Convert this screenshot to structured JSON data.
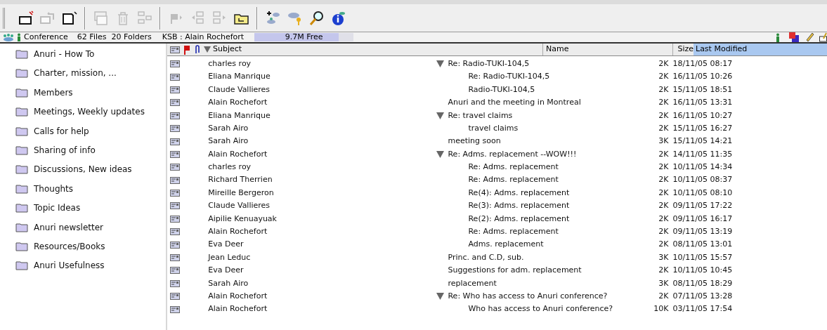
{
  "toolbar": {
    "groups": [
      [
        {
          "disabled": false
        },
        {
          "disabled": true
        },
        {
          "disabled": false
        }
      ],
      [
        {
          "disabled": true
        },
        {
          "disabled": true
        },
        {
          "disabled": true
        }
      ],
      [
        {
          "disabled": true
        },
        {
          "disabled": true
        },
        {
          "disabled": true
        },
        {
          "disabled": false
        }
      ],
      [
        {
          "disabled": false
        },
        {
          "disabled": false
        },
        {
          "disabled": false
        },
        {
          "disabled": false
        }
      ]
    ]
  },
  "status_bar": {
    "conference": "Conference",
    "files": "62 Files",
    "folders": "20 Folders",
    "user": "KSB : Alain Rochefort",
    "free_space": {
      "label": "9.7M Free",
      "level": 0.85
    }
  },
  "sidebar": {
    "items": [
      {
        "label": "Anuri - How To"
      },
      {
        "label": "Charter, mission, ..."
      },
      {
        "label": "Members"
      },
      {
        "label": "Meetings, Weekly updates"
      },
      {
        "label": "Calls for help"
      },
      {
        "label": "Sharing of info"
      },
      {
        "label": "Discussions, New ideas"
      },
      {
        "label": "Thoughts"
      },
      {
        "label": "Topic Ideas"
      },
      {
        "label": "Anuri newsletter"
      },
      {
        "label": "Resources/Books"
      },
      {
        "label": "Anuri Usefulness"
      }
    ]
  },
  "table": {
    "columns": [
      {
        "label": "Subject",
        "selected": false
      },
      {
        "label": "Name",
        "selected": false
      },
      {
        "label": "Size",
        "selected": false
      },
      {
        "label": "Last Modified",
        "selected": true
      }
    ],
    "rows": [
      {
        "sender": "charles roy",
        "subject": "Re: Radio-TUKI-104,5",
        "size": "2K",
        "modified": "18/11/05 08:17",
        "expanded": true,
        "children": [
          {
            "sender": "Eliana Manrique",
            "subject": "Re: Radio-TUKI-104,5",
            "size": "2K",
            "modified": "16/11/05 10:26"
          },
          {
            "sender": "Claude Vallieres",
            "subject": "Radio-TUKI-104,5",
            "size": "2K",
            "modified": "15/11/05 18:51"
          }
        ]
      },
      {
        "sender": "Alain Rochefort",
        "subject": "Anuri and the meeting in Montreal",
        "size": "2K",
        "modified": "16/11/05 13:31"
      },
      {
        "sender": "Eliana Manrique",
        "subject": "Re: travel claims",
        "size": "2K",
        "modified": "16/11/05 10:27",
        "expanded": true,
        "children": [
          {
            "sender": "Sarah Airo",
            "subject": "travel claims",
            "size": "2K",
            "modified": "15/11/05 16:27"
          }
        ]
      },
      {
        "sender": "Sarah Airo",
        "subject": "meeting soon",
        "size": "3K",
        "modified": "15/11/05 14:21"
      },
      {
        "sender": "Alain Rochefort",
        "subject": "Re: Adms. replacement --WOW!!!",
        "size": "2K",
        "modified": "14/11/05 11:35",
        "expanded": true,
        "children": [
          {
            "sender": "charles roy",
            "subject": "Re: Adms. replacement",
            "size": "2K",
            "modified": "10/11/05 14:34"
          },
          {
            "sender": "Richard Therrien",
            "subject": "Re: Adms. replacement",
            "size": "2K",
            "modified": "10/11/05 08:37"
          },
          {
            "sender": "Mireille Bergeron",
            "subject": "Re(4): Adms. replacement",
            "size": "2K",
            "modified": "10/11/05 08:10"
          },
          {
            "sender": "Claude Vallieres",
            "subject": "Re(3): Adms. replacement",
            "size": "2K",
            "modified": "09/11/05 17:22"
          },
          {
            "sender": "Aipilie Kenuayuak",
            "subject": "Re(2): Adms. replacement",
            "size": "2K",
            "modified": "09/11/05 16:17"
          },
          {
            "sender": "Alain Rochefort",
            "subject": "Re: Adms. replacement",
            "size": "2K",
            "modified": "09/11/05 13:19"
          },
          {
            "sender": "Eva Deer",
            "subject": "Adms. replacement",
            "size": "2K",
            "modified": "08/11/05 13:01"
          }
        ]
      },
      {
        "sender": "Jean Leduc",
        "subject": "Princ. and C.D, sub.",
        "size": "3K",
        "modified": "10/11/05 15:57"
      },
      {
        "sender": "Eva Deer",
        "subject": "Suggestions for adm. replacement",
        "size": "2K",
        "modified": "10/11/05 10:45"
      },
      {
        "sender": "Sarah Airo",
        "subject": "replacement",
        "size": "3K",
        "modified": "08/11/05 18:29"
      },
      {
        "sender": "Alain Rochefort",
        "subject": "Re: Who has access to Anuri conference?",
        "size": "2K",
        "modified": "07/11/05 13:28",
        "expanded": true,
        "children": [
          {
            "sender": "Alain Rochefort",
            "subject": "Who has access to Anuri conference?",
            "size": "10K",
            "modified": "03/11/05 17:54"
          }
        ]
      }
    ]
  }
}
